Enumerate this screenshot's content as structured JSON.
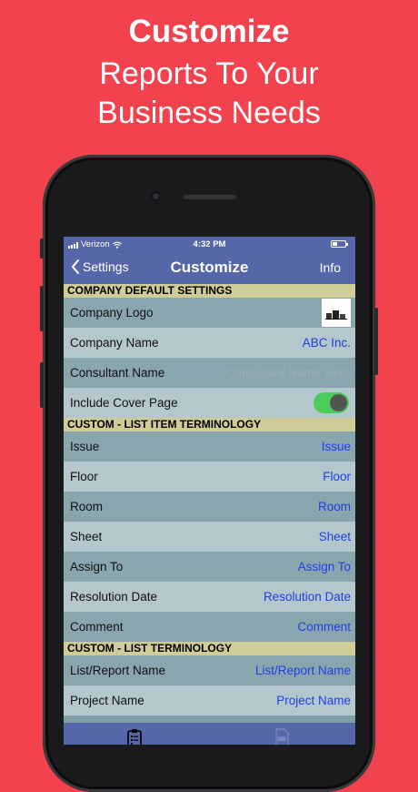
{
  "headline": {
    "line1": "Customize",
    "line2": "Reports To Your",
    "line3": "Business Needs"
  },
  "status": {
    "carrier": "Verizon",
    "time": "4:32 PM"
  },
  "nav": {
    "back_label": "Settings",
    "title": "Customize",
    "info_label": "Info"
  },
  "sections": {
    "company": "COMPANY DEFAULT SETTINGS",
    "list_item": "CUSTOM - LIST ITEM TERMINOLOGY",
    "list": "CUSTOM - LIST TERMINOLOGY"
  },
  "company_rows": {
    "logo": {
      "label": "Company Logo"
    },
    "name": {
      "label": "Company Name",
      "value": "ABC Inc."
    },
    "consultant": {
      "label": "Consultant Name",
      "placeholder": "Consultant Name Here"
    },
    "cover": {
      "label": "Include Cover Page",
      "enabled": true
    }
  },
  "list_item_rows": [
    {
      "label": "Issue",
      "value": "Issue"
    },
    {
      "label": "Floor",
      "value": "Floor"
    },
    {
      "label": "Room",
      "value": "Room"
    },
    {
      "label": "Sheet",
      "value": "Sheet"
    },
    {
      "label": "Assign To",
      "value": "Assign To"
    },
    {
      "label": "Resolution Date",
      "value": "Resolution Date"
    },
    {
      "label": "Comment",
      "value": "Comment"
    }
  ],
  "list_rows": [
    {
      "label": "List/Report Name",
      "value": "List/Report Name"
    },
    {
      "label": "Project Name",
      "value": "Project Name"
    }
  ],
  "colors": {
    "background": "#f2424e",
    "nav": "#5567a9",
    "section": "#cfcc98",
    "value_text": "#1f40e8",
    "toggle_on": "#4ccc5a"
  },
  "icons": {
    "tab1": "clipboard-checklist-icon",
    "tab2": "pdf-file-icon"
  }
}
